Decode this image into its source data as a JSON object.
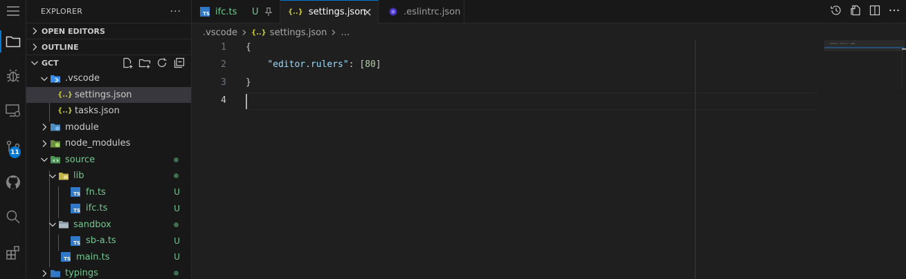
{
  "explorer": {
    "title": "EXPLORER",
    "more": "···",
    "sections": {
      "open_editors": "OPEN EDITORS",
      "outline": "OUTLINE",
      "workspace": "GCT"
    },
    "tree": [
      {
        "label": ".vscode",
        "status": ""
      },
      {
        "label": "settings.json",
        "status": ""
      },
      {
        "label": "tasks.json",
        "status": ""
      },
      {
        "label": "module",
        "status": ""
      },
      {
        "label": "node_modules",
        "status": ""
      },
      {
        "label": "source",
        "status": ""
      },
      {
        "label": "lib",
        "status": ""
      },
      {
        "label": "fn.ts",
        "status": "U"
      },
      {
        "label": "ifc.ts",
        "status": "U"
      },
      {
        "label": "sandbox",
        "status": ""
      },
      {
        "label": "sb-a.ts",
        "status": "U"
      },
      {
        "label": "main.ts",
        "status": "U"
      },
      {
        "label": "typings",
        "status": ""
      }
    ]
  },
  "activity": {
    "source_control_badge": "11"
  },
  "tabs": [
    {
      "label": "ifc.ts",
      "status": "U"
    },
    {
      "label": "settings.json",
      "close": "×"
    },
    {
      "label": ".eslintrc.json"
    }
  ],
  "file_icons": {
    "ts": "TS",
    "json": "{..}"
  },
  "breadcrumb": {
    "folder": ".vscode",
    "file": "settings.json",
    "more": "…"
  },
  "editor": {
    "line_numbers": [
      "1",
      "2",
      "3",
      "4"
    ],
    "lines": {
      "l1": "{",
      "l2_indent": "    ",
      "l2_key": "\"editor.rulers\"",
      "l2_sep": ": [",
      "l2_num": "80",
      "l2_end": "]",
      "l3": "}"
    },
    "minimap_text": "\"editor.rulers\": [80]"
  },
  "colors": {
    "accent": "#0078d4",
    "untracked": "#73c991",
    "json_key": "#9cdcfe",
    "number": "#b5cea8"
  }
}
